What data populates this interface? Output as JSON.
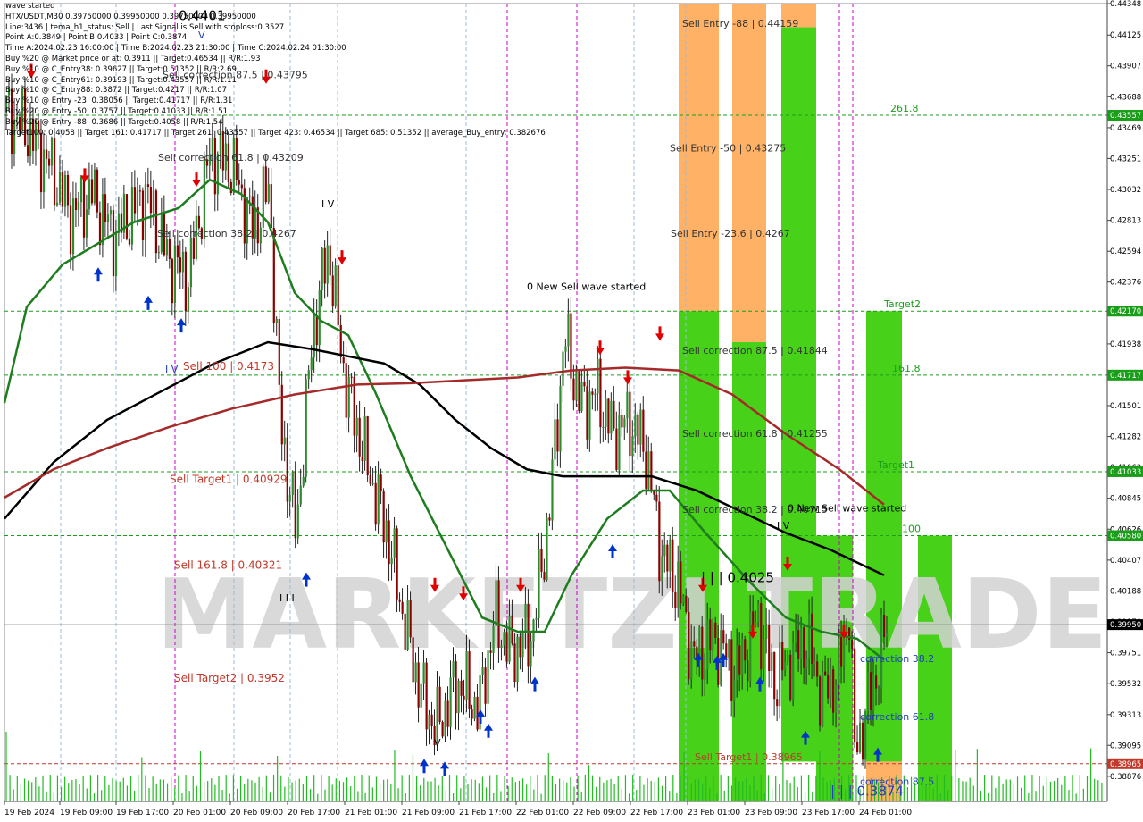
{
  "chart_data": {
    "type": "candlestick",
    "title": "wave started",
    "symbol_line": "HTX/USDT,M30  0.39750000 0.39950000 0.39750000 0.39950000",
    "info_lines": [
      "Line:3436 | tema_h1_status: Sell | Last Signal is:Sell with stoploss:0.3527",
      "Point A:0.3849 | Point B:0.4033 | Point C:0.3874",
      "Time A:2024.02.23 16:00:00 | Time B:2024.02.23 21:30:00 | Time C:2024.02.24 01:30:00",
      "Buy %20 @ Market price or at: 0.3911 || Target:0.46534 || R/R:1.93",
      "Buy %10 @ C_Entry38: 0.39627 || Target:0.51352 || R/R:2.69",
      "Buy %10 @ C_Entry61: 0.39193 || Target:0.43557 || R/R:1.11",
      "Buy %10 @ C_Entry88: 0.3872 || Target:0.4217 || R/R:1.07",
      "Buy %10 @ Entry -23: 0.38056 || Target:0.41717 || R/R:1.31",
      "Buy %20 @ Entry -50: 0.3757 || Target:0.41033 || R/R:1.51",
      "Buy %20 @ Entry -88: 0.3686 || Target:0.4058 || R/R:1.54",
      "Target100: 0.4058 || Target 161: 0.41717 || Target 261: 0.43557 || Target 423: 0.46534 || Target 685: 0.51352 || average_Buy_entry: 0.382676"
    ],
    "ylim": [
      0.38698,
      0.44348
    ],
    "y_ticks": [
      "0.44348",
      "0.44125",
      "0.43907",
      "0.43688",
      "0.43469",
      "0.43251",
      "0.43032",
      "0.42813",
      "0.42594",
      "0.42376",
      "0.42157",
      "0.41938",
      "0.41720",
      "0.41501",
      "0.41282",
      "0.41063",
      "0.40845",
      "0.40626",
      "0.40407",
      "0.40188",
      "0.39970",
      "0.39751",
      "0.39532",
      "0.39313",
      "0.39095",
      "0.38876",
      "0.38657"
    ],
    "x_labels": [
      "19 Feb 2024",
      "19 Feb 09:00",
      "19 Feb 17:00",
      "20 Feb 01:00",
      "20 Feb 09:00",
      "20 Feb 17:00",
      "21 Feb 01:00",
      "21 Feb 09:00",
      "21 Feb 17:00",
      "22 Feb 01:00",
      "22 Feb 09:00",
      "22 Feb 17:00",
      "23 Feb 01:00",
      "23 Feb 09:00",
      "23 Feb 17:00",
      "24 Feb 01:00"
    ],
    "price_tags": [
      {
        "label": "0.43557",
        "value": 0.43557,
        "color": "#1a9e1a"
      },
      {
        "label": "0.42170",
        "value": 0.4217,
        "color": "#1a9e1a"
      },
      {
        "label": "0.41717",
        "value": 0.41717,
        "color": "#1a9e1a"
      },
      {
        "label": "0.41033",
        "value": 0.41033,
        "color": "#1a9e1a"
      },
      {
        "label": "0.40580",
        "value": 0.4058,
        "color": "#1a9e1a"
      },
      {
        "label": "0.39950",
        "value": 0.3995,
        "color": "#000000"
      },
      {
        "label": "0.38965",
        "value": 0.38965,
        "color": "#c0392b"
      }
    ],
    "level_labels": [
      {
        "text": "Sell Entry -88 | 0.44159",
        "value": 0.44159,
        "color": "#333333"
      },
      {
        "text": "Sell Entry -50 | 0.43275",
        "value": 0.43275,
        "color": "#333333"
      },
      {
        "text": "Sell Entry -23.6 | 0.4267",
        "value": 0.4267,
        "color": "#333333"
      },
      {
        "text": "Sell correction 87.5 | 0.41844",
        "value": 0.41844,
        "color": "#333333"
      },
      {
        "text": "Sell correction 61.8 | 0.41255",
        "value": 0.41255,
        "color": "#333333"
      },
      {
        "text": "Sell correction 38.2 | 0.40715",
        "value": 0.40715,
        "color": "#333333"
      },
      {
        "text": "Sell Target1 | 0.38965",
        "value": 0.38965,
        "color": "#c0392b"
      },
      {
        "text": "Sell 100 | 0.4173",
        "value": 0.4173,
        "color": "#c0392b"
      },
      {
        "text": "Sell Target1 | 0.40929",
        "value": 0.40929,
        "color": "#c0392b"
      },
      {
        "text": "Sell 161.8 | 0.40321",
        "value": 0.40321,
        "color": "#c0392b"
      },
      {
        "text": "Sell Target2 | 0.3952",
        "value": 0.3952,
        "color": "#c0392b"
      },
      {
        "text": "Sell correction 61.8 | 0.43209",
        "value": 0.43209,
        "color": "#333333"
      },
      {
        "text": "Sell correction 38.2 | 0.4267",
        "value": 0.4267,
        "color": "#333333"
      },
      {
        "text": "Sell correction 87.5 | 0.43795",
        "value": 0.43795,
        "color": "#333333"
      },
      {
        "text": "261.8",
        "value": 0.43557,
        "color": "#1a9e1a"
      },
      {
        "text": "Target2",
        "value": 0.4217,
        "color": "#1a9e1a"
      },
      {
        "text": "161.8",
        "value": 0.41717,
        "color": "#1a9e1a"
      },
      {
        "text": "Target1",
        "value": 0.41033,
        "color": "#1a9e1a"
      },
      {
        "text": "100",
        "value": 0.4058,
        "color": "#1a9e1a"
      },
      {
        "text": "correction 38.2",
        "value": 0.3966,
        "color": "#1f3fbf"
      },
      {
        "text": "correction 61.8",
        "value": 0.3925,
        "color": "#1f3fbf"
      },
      {
        "text": "correction 87.5",
        "value": 0.3879,
        "color": "#1f3fbf"
      }
    ],
    "annotations": [
      {
        "text": "0 New Sell wave started",
        "value": 0.4232
      },
      {
        "text": "0 New Sell wave started",
        "value": 0.4075
      },
      {
        "text": "| | | 0.4025",
        "value": 0.4025
      },
      {
        "text": "| | | 0.3874",
        "value": 0.3874
      },
      {
        "text": "0.4401",
        "value": 0.4423
      }
    ],
    "watermark": "MARKETZI TRADE",
    "series": [
      {
        "type": "line",
        "color": "#1e7d1e"
      },
      {
        "type": "line",
        "color": "#000000"
      },
      {
        "type": "line",
        "color": "#a52a2a"
      }
    ]
  }
}
